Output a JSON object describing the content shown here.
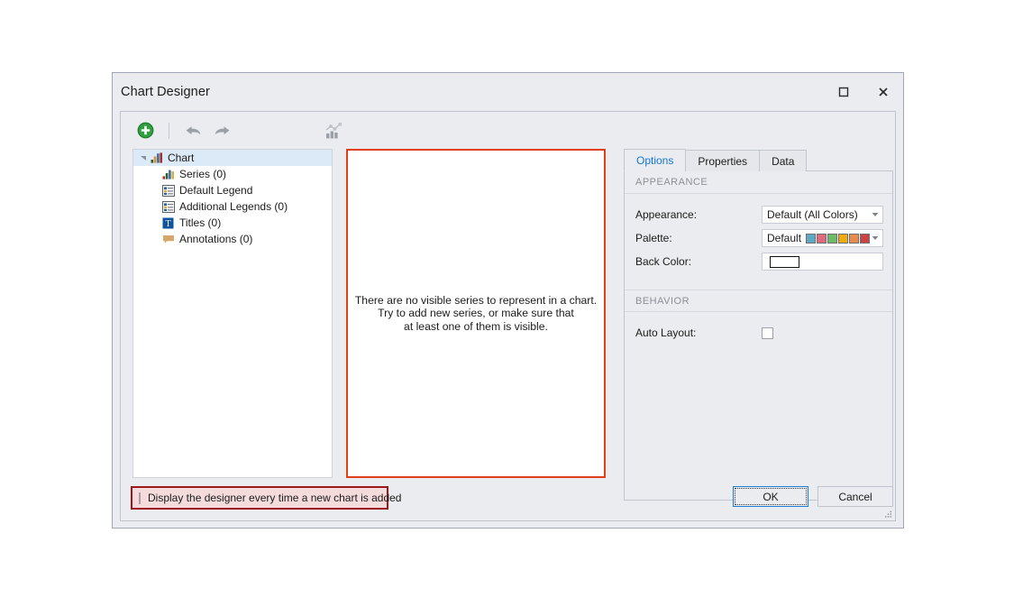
{
  "window": {
    "title": "Chart Designer",
    "maximize_icon": "maximize-icon",
    "close_icon": "close-icon"
  },
  "toolbar": {
    "items": [
      {
        "name": "add-button",
        "icon": "plus-circle-icon",
        "label": ""
      },
      {
        "name": "undo-button",
        "icon": "undo-arrow-icon",
        "label": ""
      },
      {
        "name": "redo-button",
        "icon": "redo-arrow-icon",
        "label": ""
      },
      {
        "name": "chart-type-button",
        "icon": "chart-icon",
        "label": ""
      }
    ]
  },
  "tree": {
    "nodes": [
      {
        "label": "Chart",
        "icon": "bar-chart-icon",
        "level": 0,
        "selected": true,
        "expanded": true
      },
      {
        "label": "Series (0)",
        "icon": "bar-chart-icon",
        "level": 1,
        "selected": false
      },
      {
        "label": "Default Legend",
        "icon": "legend-icon",
        "level": 1,
        "selected": false
      },
      {
        "label": "Additional Legends (0)",
        "icon": "legend-icon",
        "level": 1,
        "selected": false
      },
      {
        "label": "Titles (0)",
        "icon": "text-title-icon",
        "level": 1,
        "selected": false
      },
      {
        "label": "Annotations (0)",
        "icon": "annotation-icon",
        "level": 1,
        "selected": false
      }
    ]
  },
  "preview": {
    "message": "There are no visible series to represent in a chart.\nTry to add new series, or make sure that\nat least one of them is visible.",
    "border_color": "#e0401c"
  },
  "tabs": [
    {
      "label": "Options",
      "active": true
    },
    {
      "label": "Properties",
      "active": false
    },
    {
      "label": "Data",
      "active": false
    }
  ],
  "options": {
    "appearance_group": "APPEARANCE",
    "appearance": {
      "label": "Appearance:",
      "value": "Default (All Colors)"
    },
    "palette": {
      "label": "Palette:",
      "value": "Default",
      "swatches": [
        "#5ea8c4",
        "#e0697e",
        "#6fb96a",
        "#f0ab12",
        "#e78a4b",
        "#cc4343"
      ]
    },
    "back_color": {
      "label": "Back Color:",
      "value": "",
      "swatch": "#ffffff"
    },
    "behavior_group": "BEHAVIOR",
    "auto_layout": {
      "label": "Auto Layout:",
      "checked": false
    }
  },
  "footer": {
    "display_designer": {
      "label": "Display the designer every time a new chart is added",
      "checked": false,
      "highlight_color": "#9c1a1a"
    },
    "ok_label": "OK",
    "cancel_label": "Cancel"
  }
}
